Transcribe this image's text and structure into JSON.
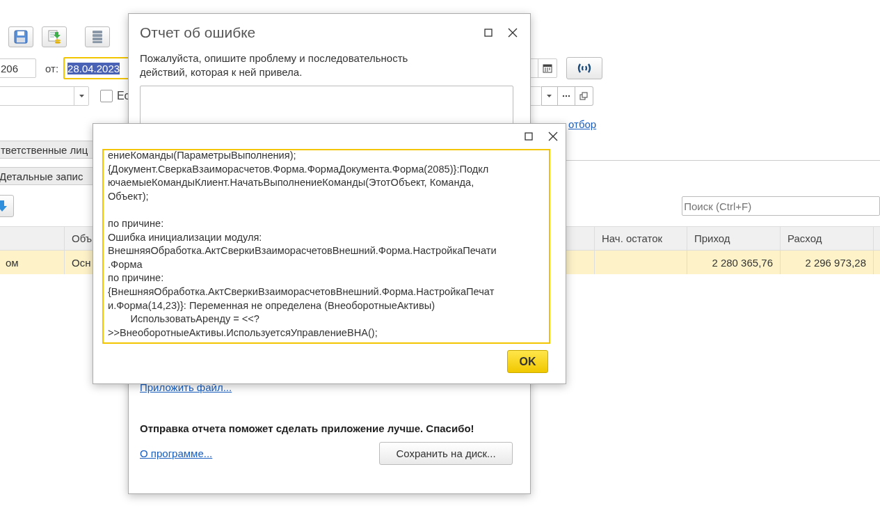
{
  "form": {
    "toolbar": [
      {
        "kind": "save"
      },
      {
        "kind": "load"
      },
      {
        "kind": "list"
      }
    ],
    "number_field": {
      "value": "206"
    },
    "date_label": "от:",
    "date_field": {
      "value": "28.04.2023",
      "focused": true
    },
    "checkbox": {
      "label": "Ес",
      "checked": false
    },
    "filter_link": "отбор",
    "tabs": [
      {
        "label": "тветственные лиц"
      },
      {
        "label": "Детальные запис"
      }
    ],
    "search": {
      "placeholder": "Поиск (Ctrl+F)"
    },
    "table": {
      "columns": [
        "",
        "Объ",
        "Нач. остаток",
        "Приход",
        "Расход",
        ""
      ],
      "rows": [
        {
          "cells": [
            "ом",
            "Осн",
            "",
            "2 280 365,76",
            "2 296 973,28",
            ""
          ],
          "selected": true
        }
      ]
    }
  },
  "report_dialog": {
    "title": "Отчет об ошибке",
    "description": "Пожалуйста, опишите проблему и последовательность действий, которая к ней привела.",
    "attach_link": "Приложить файл...",
    "thanks": "Отправка отчета поможет сделать приложение лучше. Спасибо!",
    "about_link": "О программе...",
    "save_button": "Сохранить на диск..."
  },
  "error_dialog": {
    "blocks": [
      [
        "ениеКоманды(ПараметрыВыполнения);",
        "{Документ.СверкаВзаиморасчетов.Форма.ФормаДокумента.Форма(2085)}:Подкл",
        "ючаемыеКомандыКлиент.НачатьВыполнениеКоманды(ЭтотОбъект, Команда,",
        "Объект);"
      ],
      [
        "по причине:",
        "Ошибка инициализации модуля:",
        "ВнешняяОбработка.АктСверкиВзаиморасчетовВнешний.Форма.НастройкаПечати",
        ".Форма",
        "по причине:",
        "{ВнешняяОбработка.АктСверкиВзаиморасчетовВнешний.Форма.НастройкаПечат",
        "и.Форма(14,23)}: Переменная не определена (ВнеоборотныеАктивы)",
        "        ИспользоватьАренду = <<?",
        ">>ВнеоборотныеАктивы.ИспользуетсяУправлениеВНА();"
      ]
    ],
    "ok_button": "OK"
  }
}
